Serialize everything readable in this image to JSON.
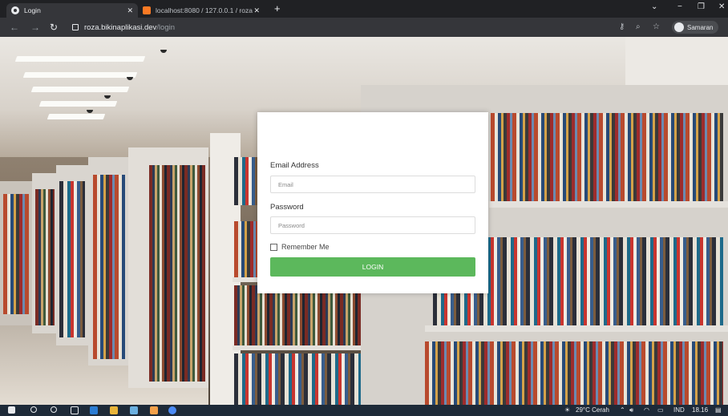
{
  "browser": {
    "tabs": [
      {
        "title": "Login",
        "icon": "globe-icon",
        "active": true
      },
      {
        "title": "localhost:8080 / 127.0.0.1 / roza",
        "icon": "xampp-icon",
        "active": false
      }
    ],
    "new_tab_glyph": "+",
    "url_host": "roza.bikinaplikasi.dev",
    "url_path": "/login",
    "profile_name": "Samaran",
    "window_controls": {
      "collapse": "⌄",
      "minimize": "−",
      "restore": "❐",
      "close": "✕"
    }
  },
  "login": {
    "email_label": "Email Address",
    "email_placeholder": "Email",
    "password_label": "Password",
    "password_placeholder": "Password",
    "remember_label": "Remember Me",
    "submit_label": "LOGIN",
    "submit_color": "#5cb85c"
  },
  "taskbar": {
    "weather": "29°C Cerah",
    "language": "IND",
    "time": "18.16"
  }
}
